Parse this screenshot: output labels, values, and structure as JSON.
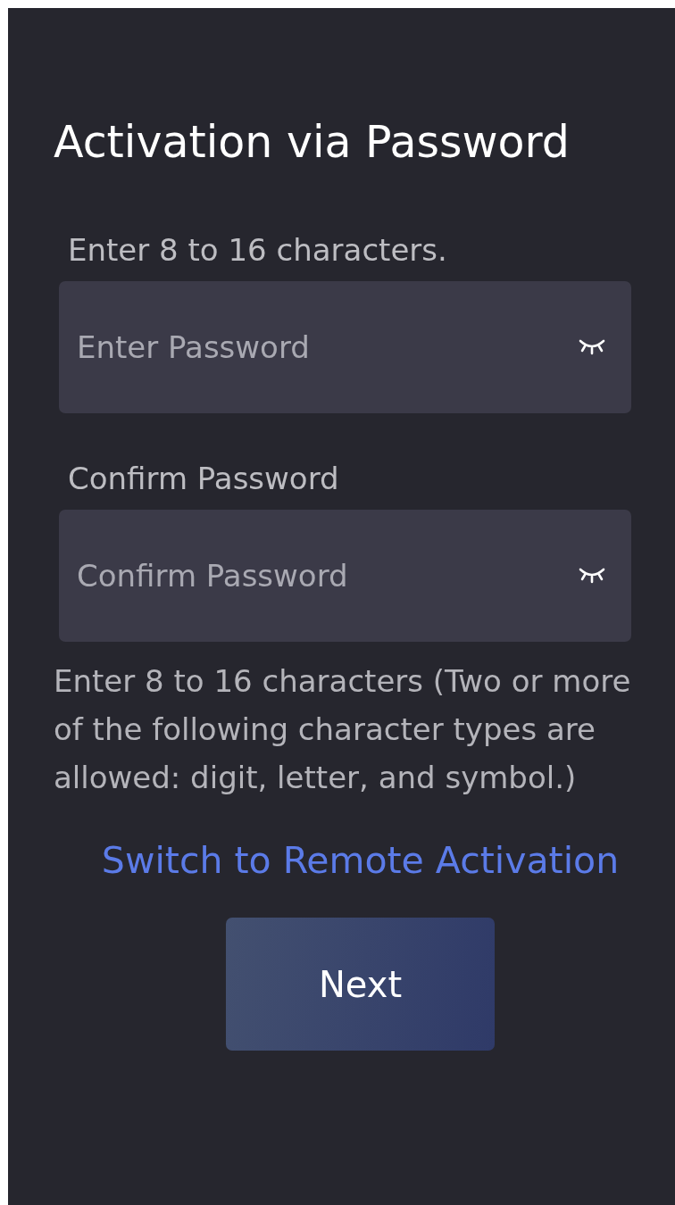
{
  "title": "Activation via Password",
  "fields": [
    {
      "label": "Enter 8 to 16 characters.",
      "placeholder": "Enter Password",
      "masked": true
    },
    {
      "label": "Confirm Password",
      "placeholder": "Confirm Password",
      "masked": true
    }
  ],
  "hint": "Enter 8 to 16 characters (Two or more of the following character types are allowed: digit, letter, and symbol.)",
  "link": "Switch to Remote Activation",
  "button": "Next"
}
